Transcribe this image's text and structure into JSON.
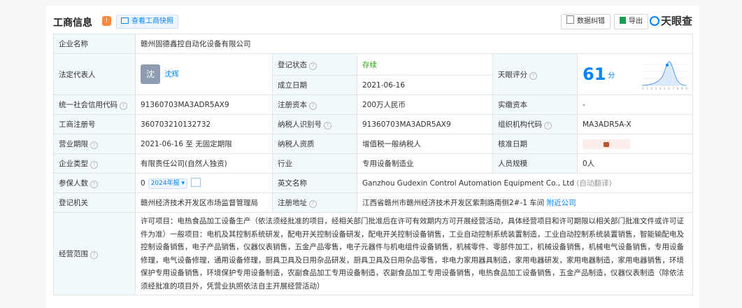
{
  "header": {
    "title": "工商信息",
    "snapshot_button": "查看工商快照",
    "error_button": "数据纠错",
    "export_button": "导出",
    "brand": "天眼查"
  },
  "company_name": {
    "label": "企业名称",
    "value": "赣州固德鑫控自动化设备有限公司"
  },
  "legal_rep": {
    "label": "法定代表人",
    "avatar": "沈",
    "name": "沈辉"
  },
  "status": {
    "label": "登记状态",
    "value": "存续"
  },
  "established": {
    "label": "成立日期",
    "value": "2021-06-16"
  },
  "score": {
    "label": "天眼评分",
    "value": "61",
    "unit": "分",
    "chart_axis": [
      "0",
      "1",
      "2",
      "3",
      "4",
      "5",
      "6",
      "7",
      "8",
      "9",
      "10"
    ]
  },
  "credit_code": {
    "label": "统一社会信用代码",
    "value": "91360703MA3ADR5AX9"
  },
  "reg_capital": {
    "label": "注册资本",
    "value": "200万人民币"
  },
  "paid_capital": {
    "label": "实缴资本",
    "value": "-"
  },
  "reg_number": {
    "label": "工商注册号",
    "value": "360703210132732"
  },
  "taxpayer_id": {
    "label": "纳税人识别号",
    "value": "91360703MA3ADR5AX9"
  },
  "org_code": {
    "label": "组织机构代码",
    "value": "MA3ADR5A-X"
  },
  "term": {
    "label": "营业期限",
    "value": "2021-06-16 至 无固定期限"
  },
  "taxpayer_type": {
    "label": "纳税人资质",
    "value": "增值税一般纳税人"
  },
  "approval_date": {
    "label": "核准日期"
  },
  "company_type": {
    "label": "企业类型",
    "value": "有限责任公司(自然人独资)"
  },
  "industry": {
    "label": "行业",
    "value": "专用设备制造业"
  },
  "staff_size": {
    "label": "人员规模",
    "value": "0人"
  },
  "insured": {
    "label": "参保人数",
    "value": "0",
    "badge": "2024年报"
  },
  "english_name": {
    "label": "英文名称",
    "value": "Ganzhou Gudexin Control Automation Equipment Co., Ltd",
    "note": "(自动翻译)"
  },
  "reg_authority": {
    "label": "登记机关",
    "value": "赣州经济技术开发区市场监督管理局"
  },
  "address": {
    "label": "注册地址",
    "value": "江西省赣州市赣州经济技术开发区紫荆路南侧2#-1 车间",
    "link": "附近公司"
  },
  "scope": {
    "label": "经营范围",
    "value": "许可项目：电热食品加工设备生产（依法须经批准的项目，经相关部门批准后在许可有效期内方可开展经营活动，具体经营项目和许可期限以相关部门批准文件或许可证件为准）一般项目：电机及其控制系统研发，配电开关控制设备研发，配电开关控制设备销售，工业自动控制系统装置制造，工业自动控制系统装置销售，智能输配电及控制设备销售，电子产品销售，仪器仪表销售，五金产品零售，电子元器件与机电组件设备销售，机械零件、零部件加工，机械设备销售，机械电气设备销售，专用设备修理，电气设备修理，通用设备修理，厨具卫具及日用杂品研发，厨具卫具及日用杂品零售，非电力家用器具制造，家用电器研发，家用电器制造，家用电器销售，环境保护专用设备销售，环境保护专用设备制造，农副食品加工专用设备制造，农副食品加工专用设备销售，电热食品加工设备销售，五金产品制造，仪器仪表制造（除依法须经批准的项目外，凭营业执照依法自主开展经营活动）"
  },
  "colors": {
    "accent": "#0084ff",
    "label_bg": "#f2f9fc",
    "status_green": "#2aa515",
    "orange": "#ff8a3d"
  }
}
